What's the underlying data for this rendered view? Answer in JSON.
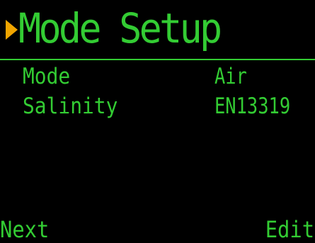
{
  "colors": {
    "background": "#000000",
    "text": "#33cc33",
    "cursor": "#f0a500"
  },
  "header": {
    "cursor_icon": "triangle-right-cursor-icon",
    "title": "Mode Setup"
  },
  "settings": [
    {
      "label": "Mode",
      "value": "Air"
    },
    {
      "label": "Salinity",
      "value": "EN13319"
    }
  ],
  "softkeys": {
    "left": "Next",
    "right": "Edit"
  }
}
